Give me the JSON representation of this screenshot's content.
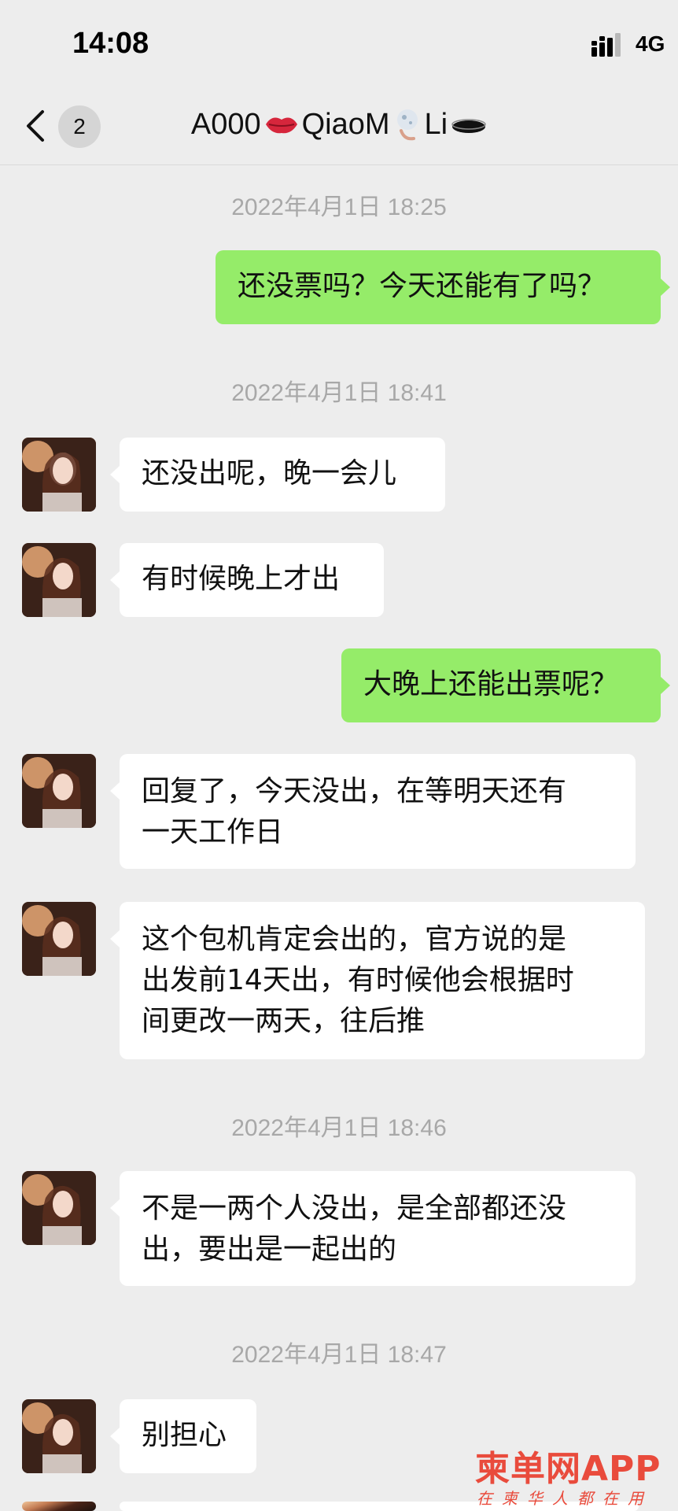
{
  "status_bar": {
    "time": "14:08",
    "network": "4G"
  },
  "nav": {
    "unread_count": "2",
    "title_part1": "A000",
    "title_part2": "QiaoM",
    "title_part3": "Li"
  },
  "messages": [
    {
      "type": "timestamp",
      "text": "2022年4月1日 18:25"
    },
    {
      "type": "out",
      "text": "还没票吗？今天还能有了吗？"
    },
    {
      "type": "timestamp",
      "text": "2022年4月1日 18:41"
    },
    {
      "type": "in",
      "text": "还没出呢，晚一会儿"
    },
    {
      "type": "in",
      "text": "有时候晚上才出"
    },
    {
      "type": "out",
      "text": "大晚上还能出票呢？"
    },
    {
      "type": "in",
      "lines": [
        "回复了，今天没出，在等明天还有",
        "一天工作日"
      ]
    },
    {
      "type": "in",
      "lines": [
        "这个包机肯定会出的，官方说的是",
        "出发前14天出，有时候他会根据时",
        "间更改一两天，往后推"
      ]
    },
    {
      "type": "timestamp",
      "text": "2022年4月1日 18:46"
    },
    {
      "type": "in",
      "lines": [
        "不是一两个人没出，是全部都还没",
        "出，要出是一起出的"
      ]
    },
    {
      "type": "timestamp",
      "text": "2022年4月1日 18:47"
    },
    {
      "type": "in",
      "text": "别担心"
    }
  ],
  "watermark": {
    "main": "柬单网APP",
    "sub": "在柬华人都在用"
  },
  "colors": {
    "background": "#ededed",
    "out_bubble": "#95ec69",
    "in_bubble": "#ffffff",
    "timestamp": "#a8a8a8",
    "watermark": "#e94b3c"
  }
}
